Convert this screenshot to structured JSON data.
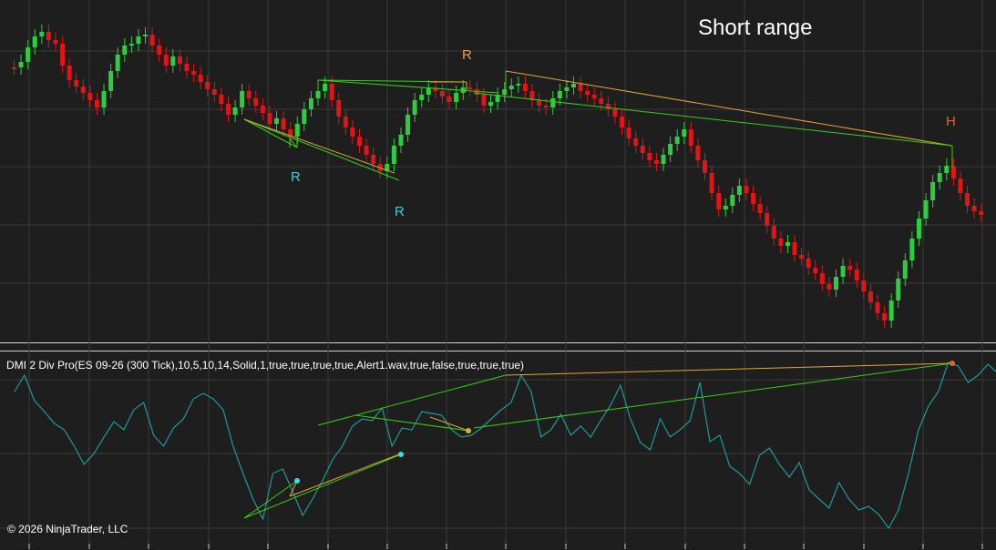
{
  "chart_title": "Short range",
  "indicator_label": "DMI 2 Div Pro(ES 09-26 (300 Tick),10,5,10,14,Solid,1,true,true,true,true,Alert1.wav,true,false,true,true,true)",
  "copyright": "© 2026 NinjaTrader, LLC",
  "markers": [
    {
      "text": "R",
      "color": "#e6a43a"
    },
    {
      "text": "R",
      "color": "#35d0e0"
    },
    {
      "text": "R",
      "color": "#35d0e0"
    },
    {
      "text": "H",
      "color": "#e0672a"
    }
  ],
  "colors": {
    "background": "#1e1e1e",
    "up_candle": "#2ecc40",
    "down_candle": "#e01515",
    "indicator_line": "#1c9a9a",
    "divergence_green": "#35d012",
    "divergence_orange": "#e6a43a",
    "grid": "#3a3a3a"
  }
}
